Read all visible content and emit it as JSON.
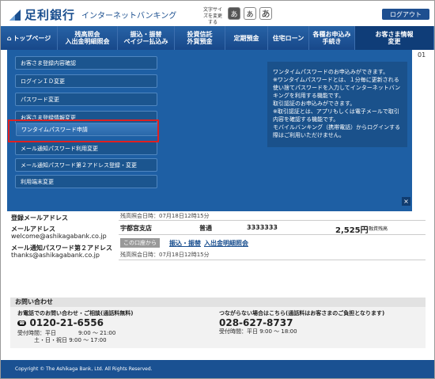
{
  "header": {
    "bank_name": "足利銀行",
    "service_name": "インターネットバンキング",
    "font_size_label": "文字サイズを変更する",
    "font_sizes": [
      "あ",
      "あ",
      "あ"
    ],
    "logout": "ログアウト"
  },
  "nav": {
    "items": [
      {
        "label": "トップページ"
      },
      {
        "label": "残高照会\n入出金明細照会"
      },
      {
        "label": "振込・振替\nペイジー払込み"
      },
      {
        "label": "投資信託\n外貨預金"
      },
      {
        "label": "定期預金"
      },
      {
        "label": "住宅ローン"
      },
      {
        "label": "各種お申込み\n手続き"
      },
      {
        "label": "お客さま情報\n変更"
      }
    ]
  },
  "menu": {
    "items": [
      "お客さま登録内容確認",
      "ログインＩＤ変更",
      "パスワード変更",
      "お客さま登録情報変更",
      "ワンタイムパスワード申請",
      "メール通知パスワード利用変更",
      "メール通知パスワード第２アドレス登録・変更",
      "利用端末変更"
    ],
    "selected_index": 4
  },
  "info": {
    "lines": [
      "ワンタイムパスワードのお申込みができます。",
      "※ワンタイムパスワードとは、１分毎に更新される使い捨てパスワードを入力してインターネットバンキングを利用する機能です。",
      "取引認証のお申込みができます。",
      "※取引認証とは、アプリもしくは電子メールで取引内容を確認する機能です。",
      "モバイルバンキング（携帯電話）からログインする際はご利用いただけません。"
    ]
  },
  "page": {
    "number_fragment": "01",
    "email_title": "登録メールアドレス",
    "email_label": "メールアドレス",
    "email": "welcome@ashikagabank.co.jp",
    "email2_label": "メール通知パスワード第２アドレス",
    "email2": "thanks@ashikagabank.co.jp",
    "balance_time1": "残高照会日時：07月18日12時15分",
    "branch": "宇都宮支店",
    "account_type": "普通",
    "account_no": "3333333",
    "amount": "2,525円",
    "amount_note": "融資残高",
    "from_label": "この口座から",
    "link1": "振込・振替",
    "link2": "入出金明細照会",
    "balance_time2": "残高照会日時：07月18日12時15分"
  },
  "inquiry": {
    "title": "お問い合わせ",
    "phone_title": "お電話でのお問い合わせ・ご相談(通話料無料)",
    "phone": "0120-21-6556",
    "hours1": "受付時間：平日　　　　9:00 ～ 21:00",
    "hours2": "　　　土・日・祝日 9:00 ～ 17:00",
    "alt_title": "つながらない場合はこちら(通話料はお客さまのご負担となります)",
    "alt_phone": "028-627-8737",
    "alt_hours": "受付時間：平日 9:00 ～ 18:00"
  },
  "footer": {
    "copyright": "Copyright © The Ashikaga Bank, Ltd. All Rights Reserved."
  },
  "colors": {
    "brand": "#1a5192",
    "overlay": "#1e5fa4",
    "highlight": "#e02020"
  }
}
